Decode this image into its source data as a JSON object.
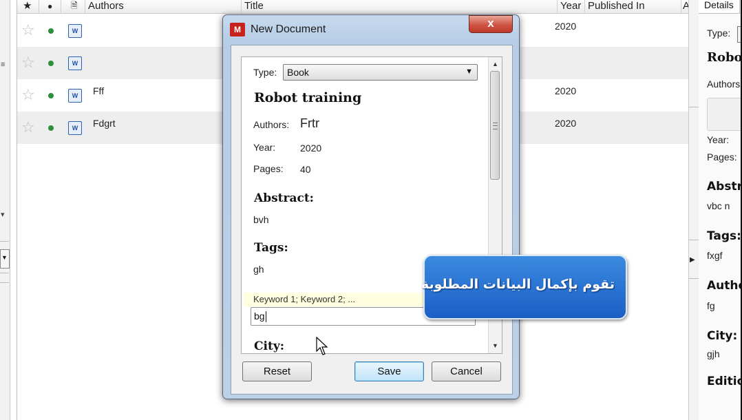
{
  "table": {
    "columns": {
      "authors": "Authors",
      "title": "Title",
      "year": "Year",
      "published_in": "Published In",
      "extra": "A"
    },
    "rows": [
      {
        "authors": "",
        "year": "2020"
      },
      {
        "authors": "",
        "year": ""
      },
      {
        "authors": "Fff",
        "year": "2020"
      },
      {
        "authors": "Fdgrt",
        "year": "2020"
      }
    ],
    "doc_icon_text": "W"
  },
  "details_panel": {
    "tab": "Details",
    "type_label": "Type:",
    "title": "Robo",
    "authors_label": "Authors",
    "year_label": "Year:",
    "pages_label": "Pages:",
    "abstract_heading": "Abstr",
    "abstract_value": "vbc n",
    "tags_heading": "Tags:",
    "tags_value": "fxgf",
    "author_keywords_heading": "Autho",
    "author_keywords_value": "fg",
    "city_heading": "City:",
    "city_value": "gjh",
    "edition_heading": "Editio"
  },
  "dialog": {
    "title": "New Document",
    "app_icon_text": "M",
    "close_symbol": "x",
    "type_label": "Type:",
    "type_value": "Book",
    "doc_title": "Robot training",
    "authors_label": "Authors:",
    "authors_value": "Frtr",
    "year_label": "Year:",
    "year_value": "2020",
    "pages_label": "Pages:",
    "pages_value": "40",
    "abstract_heading": "Abstract:",
    "abstract_value": "bvh",
    "tags_heading": "Tags:",
    "tags_value": "gh",
    "keywords_placeholder": "Keyword 1; Keyword 2; ...",
    "keywords_value": "bg",
    "city_heading": "City:",
    "buttons": {
      "reset": "Reset",
      "save": "Save",
      "cancel": "Cancel"
    }
  },
  "callout": {
    "text": "تقوم بإكمال البيانات المطلوبة"
  },
  "colors": {
    "callout_blue": "#2b74d6",
    "close_red": "#c94a3b",
    "read_dot": "#2f8f3a",
    "dialog_frame": "#bcd0e7"
  }
}
